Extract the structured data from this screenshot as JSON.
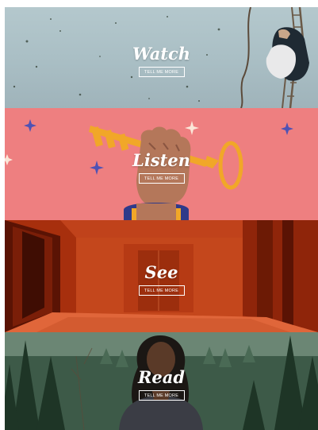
{
  "panels": [
    {
      "title": "Watch",
      "button": "TELL ME MORE"
    },
    {
      "title": "Listen",
      "button": "TELL ME MORE"
    },
    {
      "title": "See",
      "button": "TELL ME MORE"
    },
    {
      "title": "Read",
      "button": "TELL ME MORE"
    }
  ],
  "colors": {
    "watch_bg": "#b4c8cd",
    "listen_bg": "#ee7f80",
    "see_bg": "#a82f0c",
    "read_bg": "#3f5a4a",
    "text": "#ffffff"
  }
}
